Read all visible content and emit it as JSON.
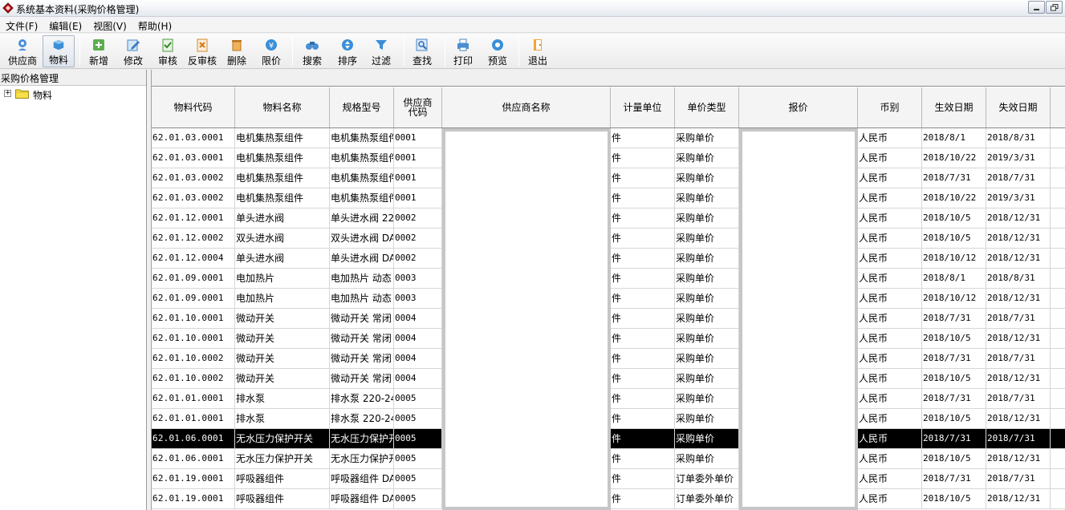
{
  "window": {
    "title": "系统基本资料(采购价格管理)",
    "buttons": [
      "minimize",
      "restore"
    ]
  },
  "menu": [
    {
      "label": "文件(F)"
    },
    {
      "label": "编辑(E)"
    },
    {
      "label": "视图(V)"
    },
    {
      "label": "帮助(H)"
    }
  ],
  "toolbar": [
    {
      "label": "供应商",
      "icon": "supplier-icon",
      "pressed": false
    },
    {
      "label": "物料",
      "icon": "material-icon",
      "pressed": true
    },
    {
      "label": "新增",
      "icon": "add-icon",
      "pressed": false
    },
    {
      "label": "修改",
      "icon": "edit-icon",
      "pressed": false
    },
    {
      "label": "审核",
      "icon": "audit-icon",
      "pressed": false
    },
    {
      "label": "反审核",
      "icon": "unaudit-icon",
      "pressed": false
    },
    {
      "label": "删除",
      "icon": "delete-icon",
      "pressed": false
    },
    {
      "label": "限价",
      "icon": "price-limit-icon",
      "pressed": false
    },
    {
      "label": "搜索",
      "icon": "binoculars-icon",
      "pressed": false
    },
    {
      "label": "排序",
      "icon": "sort-icon",
      "pressed": false
    },
    {
      "label": "过滤",
      "icon": "filter-icon",
      "pressed": false
    },
    {
      "label": "查找",
      "icon": "find-icon",
      "pressed": false
    },
    {
      "label": "打印",
      "icon": "print-icon",
      "pressed": false
    },
    {
      "label": "预览",
      "icon": "preview-icon",
      "pressed": false
    },
    {
      "label": "退出",
      "icon": "exit-icon",
      "pressed": false
    }
  ],
  "tree": {
    "header": "采购价格管理",
    "nodes": [
      {
        "label": "物料",
        "expander": "+",
        "icon": "folder-icon"
      }
    ]
  },
  "grid": {
    "columns": [
      "物料代码",
      "物料名称",
      "规格型号",
      "供应商代码",
      "供应商名称",
      "计量单位",
      "单价类型",
      "报价",
      "币别",
      "生效日期",
      "失效日期"
    ],
    "selected_row": 15,
    "rows": [
      [
        "62.01.03.0001",
        "电机集热泵组件",
        "电机集热泵组件",
        "0001",
        "",
        "件",
        "采购单价",
        "",
        "人民币",
        "2018/8/1",
        "2018/8/31"
      ],
      [
        "62.01.03.0001",
        "电机集热泵组件",
        "电机集热泵组件",
        "0001",
        "",
        "件",
        "采购单价",
        "",
        "人民币",
        "2018/10/22",
        "2019/3/31"
      ],
      [
        "62.01.03.0002",
        "电机集热泵组件",
        "电机集热泵组件",
        "0001",
        "",
        "件",
        "采购单价",
        "",
        "人民币",
        "2018/7/31",
        "2018/7/31"
      ],
      [
        "62.01.03.0002",
        "电机集热泵组件",
        "电机集热泵组件",
        "0001",
        "",
        "件",
        "采购单价",
        "",
        "人民币",
        "2018/10/22",
        "2019/3/31"
      ],
      [
        "62.01.12.0001",
        "单头进水阀",
        "单头进水阀 22",
        "0002",
        "",
        "件",
        "采购单价",
        "",
        "人民币",
        "2018/10/5",
        "2018/12/31"
      ],
      [
        "62.01.12.0002",
        "双头进水阀",
        "双头进水阀 DA",
        "0002",
        "",
        "件",
        "采购单价",
        "",
        "人民币",
        "2018/10/5",
        "2018/12/31"
      ],
      [
        "62.01.12.0004",
        "单头进水阀",
        "单头进水阀 DA",
        "0002",
        "",
        "件",
        "采购单价",
        "",
        "人民币",
        "2018/10/12",
        "2018/12/31"
      ],
      [
        "62.01.09.0001",
        "电加热片",
        "电加热片 动态",
        "0003",
        "",
        "件",
        "采购单价",
        "",
        "人民币",
        "2018/8/1",
        "2018/8/31"
      ],
      [
        "62.01.09.0001",
        "电加热片",
        "电加热片 动态",
        "0003",
        "",
        "件",
        "采购单价",
        "",
        "人民币",
        "2018/10/12",
        "2018/12/31"
      ],
      [
        "62.01.10.0001",
        "微动开关",
        "微动开关 常闭",
        "0004",
        "",
        "件",
        "采购单价",
        "",
        "人民币",
        "2018/7/31",
        "2018/7/31"
      ],
      [
        "62.01.10.0001",
        "微动开关",
        "微动开关 常闭",
        "0004",
        "",
        "件",
        "采购单价",
        "",
        "人民币",
        "2018/10/5",
        "2018/12/31"
      ],
      [
        "62.01.10.0002",
        "微动开关",
        "微动开关 常闭",
        "0004",
        "",
        "件",
        "采购单价",
        "",
        "人民币",
        "2018/7/31",
        "2018/7/31"
      ],
      [
        "62.01.10.0002",
        "微动开关",
        "微动开关 常闭",
        "0004",
        "",
        "件",
        "采购单价",
        "",
        "人民币",
        "2018/10/5",
        "2018/12/31"
      ],
      [
        "62.01.01.0001",
        "排水泵",
        "排水泵 220-24",
        "0005",
        "",
        "件",
        "采购单价",
        "",
        "人民币",
        "2018/7/31",
        "2018/7/31"
      ],
      [
        "62.01.01.0001",
        "排水泵",
        "排水泵 220-24",
        "0005",
        "",
        "件",
        "采购单价",
        "",
        "人民币",
        "2018/10/5",
        "2018/12/31"
      ],
      [
        "62.01.06.0001",
        "无水压力保护开关",
        "无水压力保护开",
        "0005",
        "",
        "件",
        "采购单价",
        "",
        "人民币",
        "2018/7/31",
        "2018/7/31"
      ],
      [
        "62.01.06.0001",
        "无水压力保护开关",
        "无水压力保护开",
        "0005",
        "",
        "件",
        "采购单价",
        "",
        "人民币",
        "2018/10/5",
        "2018/12/31"
      ],
      [
        "62.01.19.0001",
        "呼吸器组件",
        "呼吸器组件 DA",
        "0005",
        "",
        "件",
        "订单委外单价",
        "",
        "人民币",
        "2018/7/31",
        "2018/7/31"
      ],
      [
        "62.01.19.0001",
        "呼吸器组件",
        "呼吸器组件 DA",
        "0005",
        "",
        "件",
        "订单委外单价",
        "",
        "人民币",
        "2018/10/5",
        "2018/12/31"
      ]
    ]
  },
  "colors": {
    "selected_row_bg": "#000000",
    "selected_row_fg": "#ffffff",
    "mask_border": "#c6c6c6"
  }
}
